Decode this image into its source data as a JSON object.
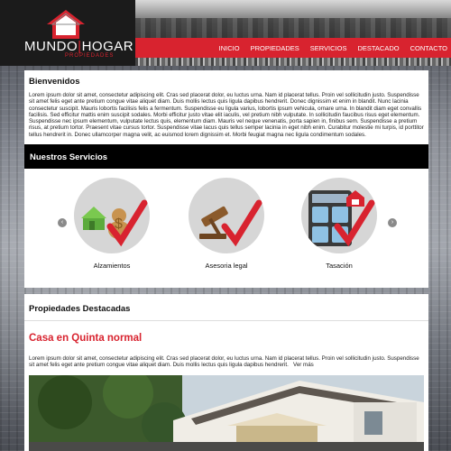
{
  "brand": {
    "name_part1": "MUNDO",
    "name_part2": "HOGAR",
    "subtitle": "PROPIEDADES",
    "accent_color": "#d8232f"
  },
  "nav": {
    "items": [
      {
        "label": "INICIO"
      },
      {
        "label": "PROPIEDADES"
      },
      {
        "label": "SERVICIOS"
      },
      {
        "label": "DESTACADO"
      },
      {
        "label": "CONTACTO"
      }
    ]
  },
  "welcome": {
    "title": "Bienvenidos",
    "text": "Lorem ipsum dolor sit amet, consectetur adipiscing elit. Cras sed placerat dolor, eu luctus urna. Nam id placerat tellus. Proin vel sollicitudin justo. Suspendisse sit amet felis eget ante pretium congue vitae aliquet diam. Duis mollis lectus quis ligula dapibus hendrerit. Donec dignissim et enim in blandit. Nunc lacinia consectetur suscipit. Mauris lobortis facilisis felis a fermentum. Suspendisse eu ligula varius, lobortis ipsum vehicula, ornare urna. In blandit diam eget convallis facilisis. Sed efficitur mattis enim suscipit sodales. Morbi efficitur justo vitae elit iaculis, vel pretium nibh vulputate. In sollicitudin faucibus risus eget elementum. Suspendisse nec ipsum elementum, vulputate lectus quis, elementum diam. Mauris vel neque venenatis, porta sapien in, finibus sem. Suspendisse a pretium risus, at pretium tortor. Praesent vitae cursus tortor. Suspendisse vitae lacus quis tellus semper lacinia in eget nibh enim. Curabitur molestie mi turpis, id porttitor tellus hendrerit in. Donec ullamcorper magna velit, ac euismod lorem dignissim et. Morbi feugiat magna nec ligula condimentum sodales."
  },
  "services": {
    "title": "Nuestros Servicios",
    "prev_icon": "chevron-left-icon",
    "next_icon": "chevron-right-icon",
    "items": [
      {
        "label": "Alzamientos",
        "icon": "house-money-check-icon"
      },
      {
        "label": "Asesoria legal",
        "icon": "gavel-check-icon"
      },
      {
        "label": "Tasación",
        "icon": "calculator-check-icon"
      }
    ]
  },
  "featured": {
    "title": "Propiedades Destacadas",
    "house": {
      "title": "Casa en Quinta normal",
      "text": "Lorem ipsum dolor sit amet, consectetur adipiscing elit. Cras sed placerat dolor, eu luctus urna. Nam id placerat tellus. Proin vel sollicitudin justo. Suspendisse sit amet felis eget ante pretium congue vitae aliquet diam. Duis mollis lectus quis ligula dapibus hendrerit.",
      "more_link": "Ver más"
    }
  }
}
